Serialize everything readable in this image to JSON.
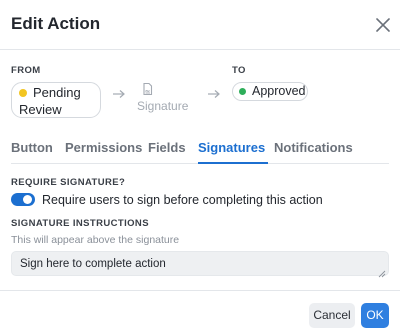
{
  "dialog": {
    "title": "Edit Action",
    "close_icon": "close-icon"
  },
  "transition": {
    "from_label": "FROM",
    "to_label": "TO",
    "from_state": {
      "line1": "Pending",
      "line2": "Review",
      "dot_color": "#f2c522"
    },
    "middle_step": {
      "label": "Signature",
      "icon": "signature-icon"
    },
    "to_state": {
      "label": "Approved",
      "dot_color": "#2eae5a"
    },
    "arrow_icon": "arrow-right-icon"
  },
  "tabs": [
    {
      "label": "Button",
      "active": false
    },
    {
      "label": "Permissions",
      "active": false
    },
    {
      "label": "Fields",
      "active": false
    },
    {
      "label": "Signatures",
      "active": true
    },
    {
      "label": "Notifications",
      "active": false
    }
  ],
  "signatures": {
    "require_label": "REQUIRE SIGNATURE?",
    "toggle_on": true,
    "toggle_text": "Require users to sign before completing this action",
    "instructions_label": "SIGNATURE INSTRUCTIONS",
    "instructions_helper": "This will appear above the signature",
    "instructions_value": "Sign here to complete action"
  },
  "footer": {
    "cancel_label": "Cancel",
    "ok_label": "OK"
  },
  "colors": {
    "accent": "#1c6fd0",
    "ok_button": "#2f7fe0"
  }
}
